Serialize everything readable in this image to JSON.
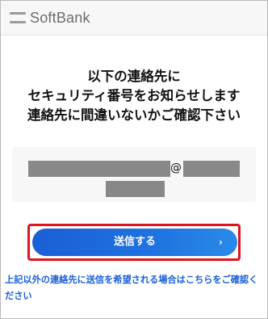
{
  "header": {
    "brand": "SoftBank",
    "logo_icon": "softbank-bars-logo"
  },
  "heading": {
    "line1": "以下の連絡先に",
    "line2": "セキュリティ番号をお知らせします",
    "line3": "連絡先に間違いないかご確認下さい"
  },
  "contact": {
    "at_symbol": "@"
  },
  "actions": {
    "send_label": "送信する",
    "send_chevron": "›",
    "highlight_color": "#e0141e",
    "alt_link": "上記以外の連絡先に送信を希望される場合はこちらをご確認ください"
  },
  "colors": {
    "accent": "#1a5fd6",
    "redaction": "#888888"
  }
}
